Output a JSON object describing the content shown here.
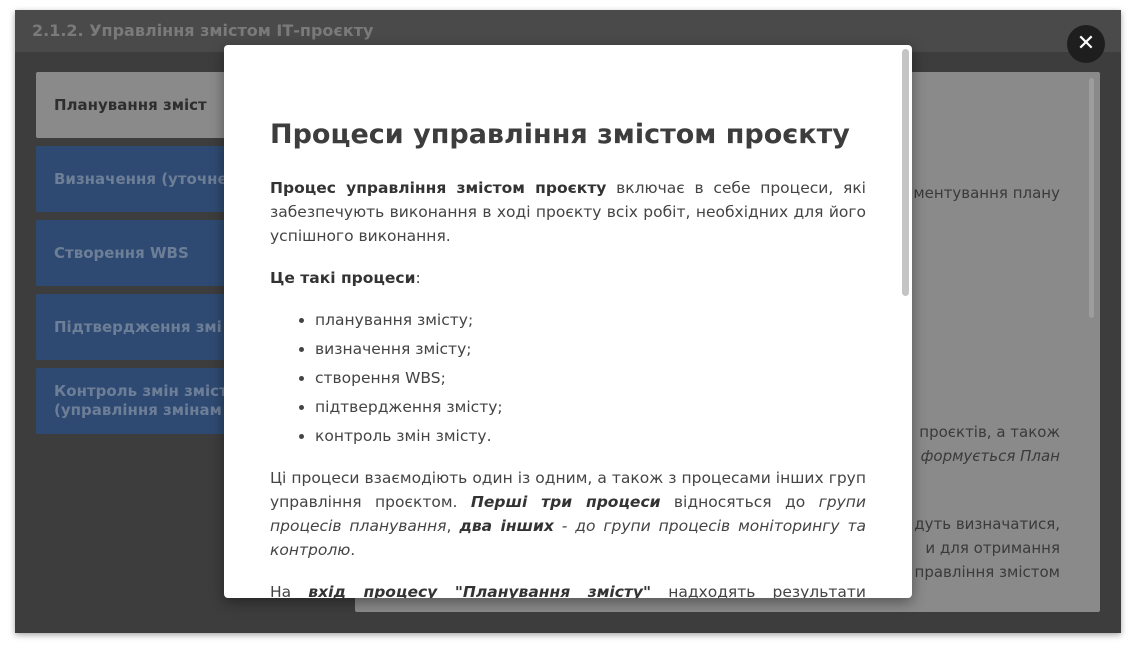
{
  "frame": {
    "title": "2.1.2. Управління змістом ІТ-проєкту"
  },
  "sidebar": {
    "items": [
      {
        "label": "Планування зміст"
      },
      {
        "label": "Визначення (уточне"
      },
      {
        "label": "Створення WBS"
      },
      {
        "label": "Підтвердження змі"
      },
      {
        "label_line1": "Контроль змін зміст",
        "label_line2": "(управління змінам"
      }
    ]
  },
  "background_panel": {
    "lines": [
      "ментування плану",
      "проєктів, а також",
      "формується План",
      "дуть визначатися,",
      "и для отримання",
      "правління змістом"
    ]
  },
  "close_button": {
    "label": "✕"
  },
  "modal": {
    "title": "Процеси управління змістом проєкту",
    "p1_bold": "Процес управління змістом проєкту",
    "p1_rest": " включає в себе процеси, які забезпечують виконання в ході проєкту всіх робіт, необхідних для його успішного виконання.",
    "p2_bold": "Це такі процеси",
    "p2_colon": ":",
    "list": [
      "планування змісту;",
      "визначення змісту;",
      "створення WBS;",
      "підтвердження змісту;",
      "контроль змін змісту."
    ],
    "p3_a": "Ці процеси взаємодіють один із одним, а також з процесами інших груп управління проєктом. ",
    "p3_b": "Перші три процеси",
    "p3_c": " відносяться до ",
    "p3_d": "групи процесів планування",
    "p3_e": ", ",
    "p3_f": "два інших",
    "p3_g": " - до ",
    "p3_h": "групи процесів моніторингу та контролю",
    "p3_i": ".",
    "p4_a": "На ",
    "p4_b": "вхід процесу \"Планування змісту\"",
    "p4_c": " надходять результати виконання"
  }
}
